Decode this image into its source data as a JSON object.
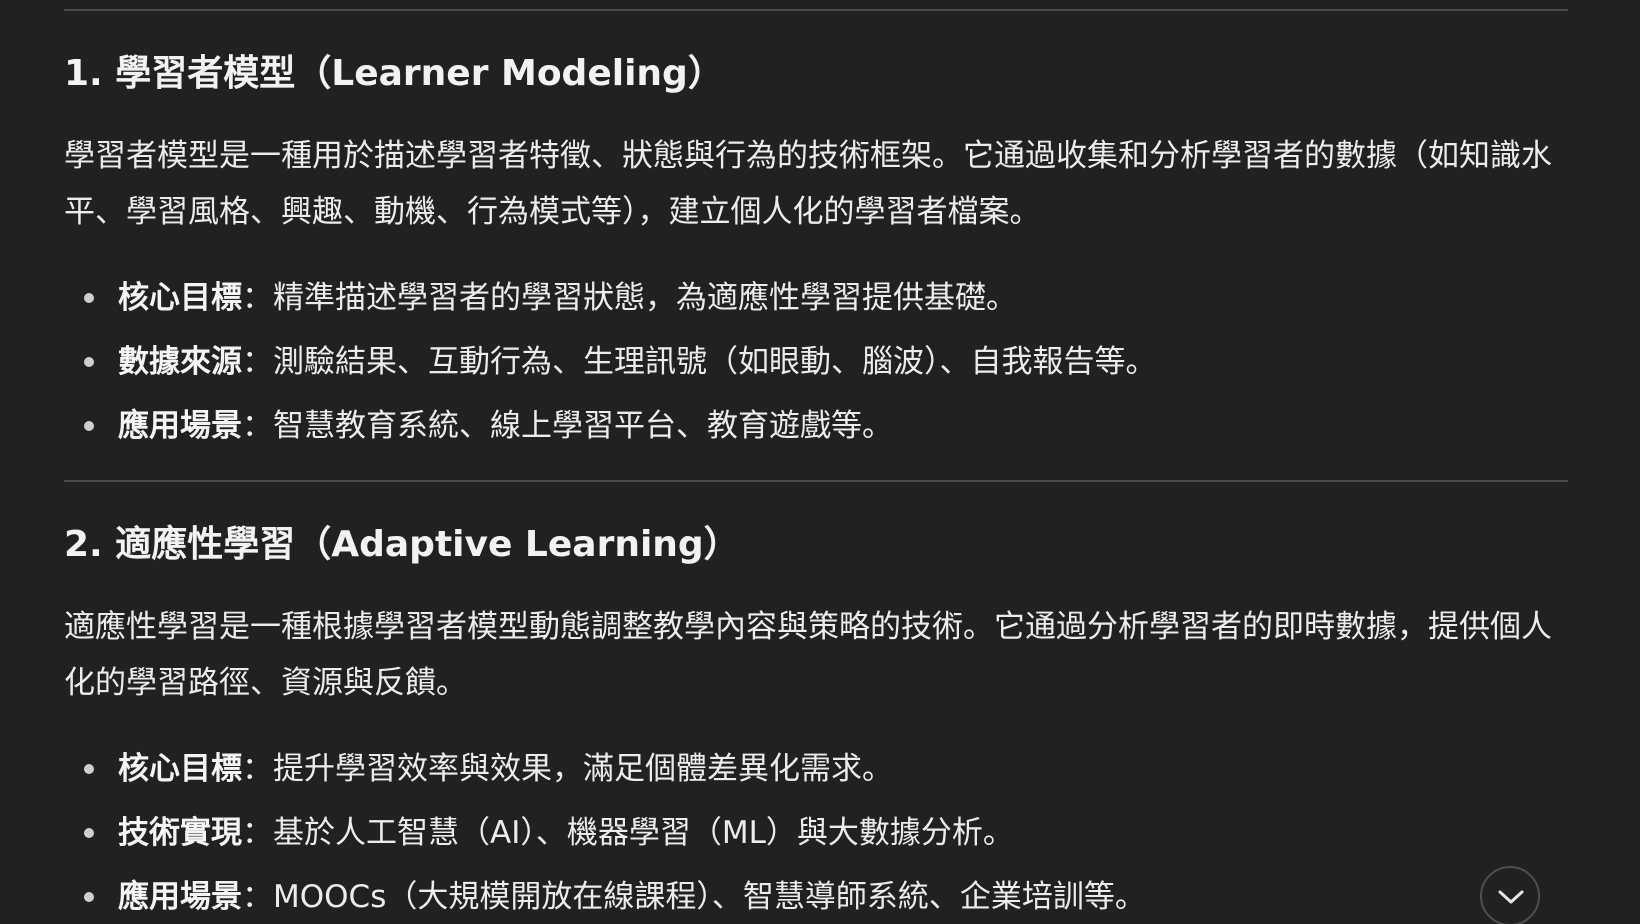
{
  "sections": [
    {
      "title": "1. 學習者模型（Learner Modeling）",
      "paragraph": "學習者模型是一種用於描述學習者特徵、狀態與行為的技術框架。它通過收集和分析學習者的數據（如知識水平、學習風格、興趣、動機、行為模式等），建立個人化的學習者檔案。",
      "bullets": [
        {
          "key": "核心目標",
          "text": "：精準描述學習者的學習狀態，為適應性學習提供基礎。"
        },
        {
          "key": "數據來源",
          "text": "：測驗結果、互動行為、生理訊號（如眼動、腦波）、自我報告等。"
        },
        {
          "key": "應用場景",
          "text": "：智慧教育系統、線上學習平台、教育遊戲等。"
        }
      ]
    },
    {
      "title": "2. 適應性學習（Adaptive Learning）",
      "paragraph": "適應性學習是一種根據學習者模型動態調整教學內容與策略的技術。它通過分析學習者的即時數據，提供個人化的學習路徑、資源與反饋。",
      "bullets": [
        {
          "key": "核心目標",
          "text": "：提升學習效率與效果，滿足個體差異化需求。"
        },
        {
          "key": "技術實現",
          "text": "：基於人工智慧（AI）、機器學習（ML）與大數據分析。"
        },
        {
          "key": "應用場景",
          "text": "：MOOCs（大規模開放在線課程）、智慧導師系統、企業培訓等。"
        }
      ]
    }
  ],
  "scroll_button": {
    "icon": "chevron-down-icon"
  },
  "colors": {
    "background": "#212121",
    "text": "#ececec",
    "divider": "#4a4a4a"
  }
}
